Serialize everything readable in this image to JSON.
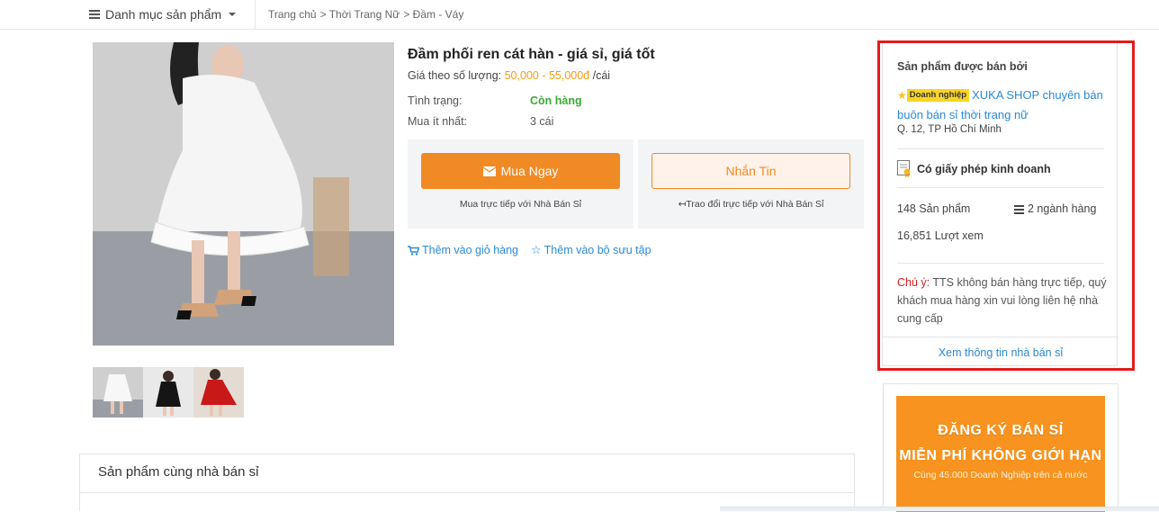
{
  "topbar": {
    "category_menu": "Danh mục sản phẩm",
    "breadcrumb": [
      "Trang chủ",
      "> Thời Trang Nữ",
      "> Đầm - Váy"
    ]
  },
  "product": {
    "title": "Đầm phối ren cát hàn - giá sỉ, giá tốt",
    "price_label": "Giá theo số lượng:",
    "price_value": "50,000 - 55,000đ",
    "price_unit": "/cái",
    "status_label": "Tình trạng:",
    "status_value": "Còn hàng",
    "min_label": "Mua ít nhất:",
    "min_value": "3 cái",
    "buy_button": "Mua Ngay",
    "buy_sub": "Mua trực tiếp với Nhà Bán Sỉ",
    "message_button": "Nhắn Tin",
    "message_sub": "↤Trao đổi trực tiếp với Nhà Bán Sỉ",
    "add_cart": "Thêm vào giỏ hàng",
    "add_collection": "Thêm vào bộ sưu tập"
  },
  "same_seller": {
    "heading": "Sản phẩm cùng nhà bán sỉ"
  },
  "seller": {
    "heading": "Sản phẩm được bán bởi",
    "badge": "Doanh nghiệp",
    "shop_name": "XUKA SHOP chuyên bán buôn bán sỉ thời trang nữ",
    "location": "Q. 12, TP Hồ Chí Minh",
    "license": "Có giấy phép kinh doanh",
    "products_count": "148 Sản phẩm",
    "categories_count": "2 ngành hàng",
    "views": "16,851 Lượt xem",
    "note_label": "Chú ý:",
    "note_text": "TTS không bán hàng trực tiếp, quý khách mua hàng xin vui lòng liên hệ nhà cung cấp",
    "footer_link": "Xem thông tin nhà bán sỉ"
  },
  "banner": {
    "line1": "ĐĂNG KÝ BÁN SỈ",
    "line2": "MIỄN PHÍ KHÔNG GIỚI HẠN",
    "line3": "Cùng 45.000 Doanh Nghiệp trên cả nước"
  },
  "colors": {
    "accent_orange": "#f08a24",
    "link_blue": "#2a8ad6",
    "highlight_red": "#e31b1b",
    "in_stock_green": "#3aa935"
  }
}
